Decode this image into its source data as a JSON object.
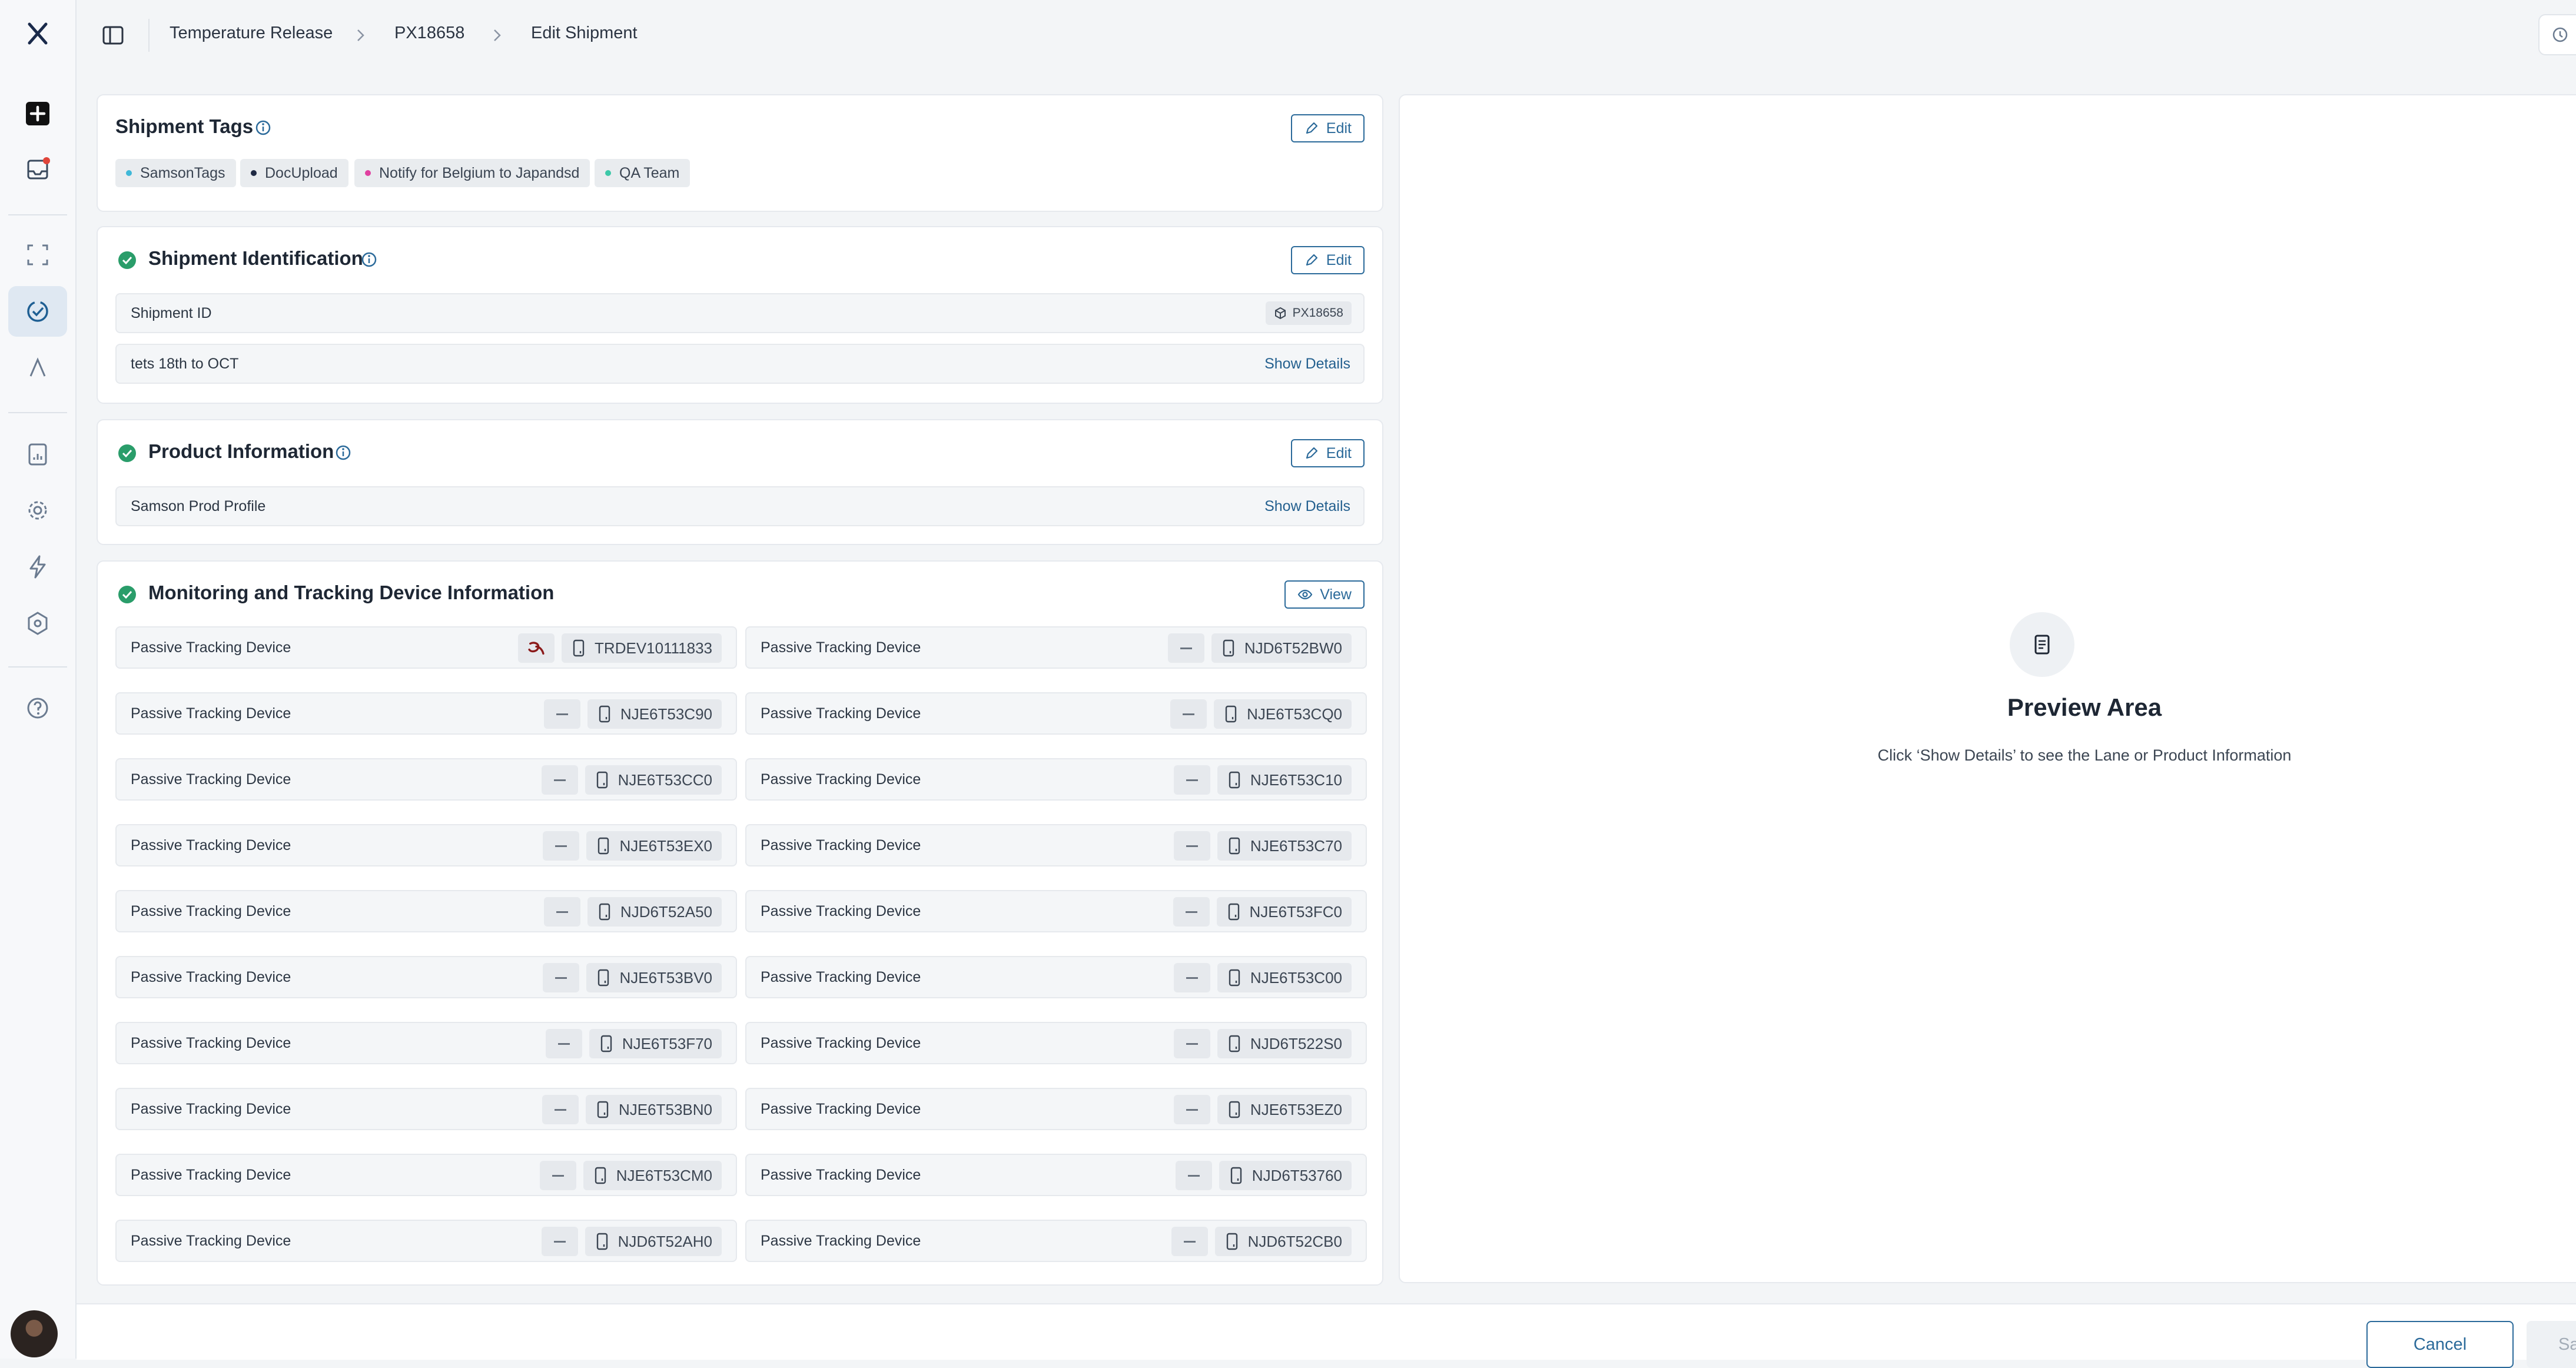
{
  "breadcrumb": [
    "Temperature Release",
    "PX18658",
    "Edit Shipment"
  ],
  "shipment_tags": {
    "title": "Shipment Tags",
    "edit_label": "Edit",
    "tags": [
      {
        "label": "SamsonTags",
        "color": "#3fb8d8"
      },
      {
        "label": "DocUpload",
        "color": "#1f2a44"
      },
      {
        "label": "Notify for Belgium to Japandsd",
        "color": "#e040a0"
      },
      {
        "label": "QA Team",
        "color": "#3cc8a8"
      }
    ]
  },
  "shipment_identification": {
    "title": "Shipment Identification",
    "edit_label": "Edit",
    "id_label": "Shipment ID",
    "id_value": "PX18658",
    "lane_label": "tets 18th to OCT",
    "show_details": "Show Details"
  },
  "product_information": {
    "title": "Product Information",
    "edit_label": "Edit",
    "profile_label": "Samson Prod Profile",
    "show_details": "Show Details"
  },
  "monitoring": {
    "title": "Monitoring and Tracking Device Information",
    "view_label": "View",
    "device_label": "Passive Tracking Device",
    "devices": [
      {
        "serial": "TRDEV10111833",
        "logo": true
      },
      {
        "serial": "NJD6T52BW0",
        "logo": false
      },
      {
        "serial": "NJE6T53C90",
        "logo": false
      },
      {
        "serial": "NJE6T53CQ0",
        "logo": false
      },
      {
        "serial": "NJE6T53CC0",
        "logo": false
      },
      {
        "serial": "NJE6T53C10",
        "logo": false
      },
      {
        "serial": "NJE6T53EX0",
        "logo": false
      },
      {
        "serial": "NJE6T53C70",
        "logo": false
      },
      {
        "serial": "NJD6T52A50",
        "logo": false
      },
      {
        "serial": "NJE6T53FC0",
        "logo": false
      },
      {
        "serial": "NJE6T53BV0",
        "logo": false
      },
      {
        "serial": "NJE6T53C00",
        "logo": false
      },
      {
        "serial": "NJE6T53F70",
        "logo": false
      },
      {
        "serial": "NJD6T522S0",
        "logo": false
      },
      {
        "serial": "NJE6T53BN0",
        "logo": false
      },
      {
        "serial": "NJE6T53EZ0",
        "logo": false
      },
      {
        "serial": "NJE6T53CM0",
        "logo": false
      },
      {
        "serial": "NJD6T53760",
        "logo": false
      },
      {
        "serial": "NJD6T52AH0",
        "logo": false
      },
      {
        "serial": "NJD6T52CB0",
        "logo": false
      }
    ]
  },
  "preview": {
    "title": "Preview Area",
    "subtitle": "Click ‘Show Details’ to see the Lane or Product Information"
  },
  "footer": {
    "cancel_label": "Cancel",
    "save_label": "Sav"
  },
  "colors": {
    "accent": "#2b6a9a",
    "success": "#2a9d6a",
    "link": "#24608f"
  }
}
